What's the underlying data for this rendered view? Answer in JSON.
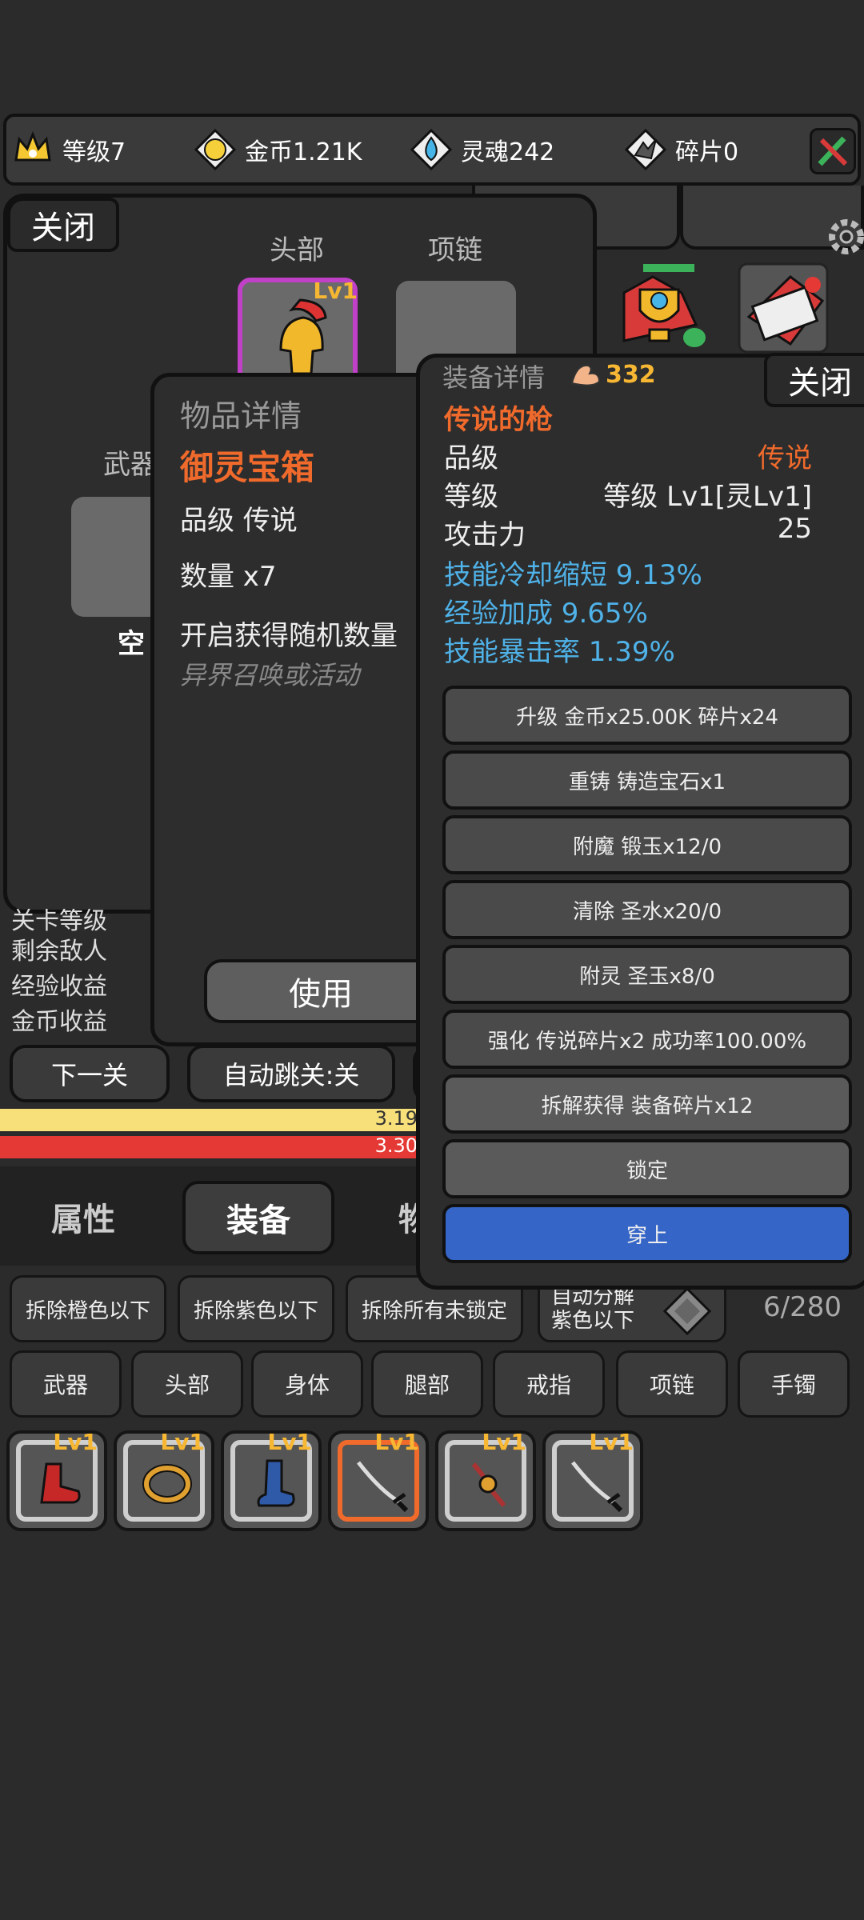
{
  "resources": {
    "level": "等级7",
    "gold": "金币1.21K",
    "soul": "灵魂242",
    "shard": "碎片0"
  },
  "equip_panel": {
    "close": "关闭",
    "slot_head": "头部",
    "slot_necklace": "项链",
    "slot_weapon": "武器",
    "empty": "空",
    "head_level": "Lv1"
  },
  "item_detail": {
    "header": "物品详情",
    "name": "御灵宝箱",
    "grade": "品级   传说",
    "quantity": "数量 x7",
    "desc": "开启获得随机数量",
    "source": "异界召唤或活动",
    "use": "使用"
  },
  "gear_detail": {
    "header": "装备详情",
    "power": "332",
    "close": "关闭",
    "name": "传说的枪",
    "grade_label": "品级",
    "grade_value": "传说",
    "level_label": "等级",
    "level_value": "等级 Lv1[灵Lv1]",
    "attack_label": "攻击力",
    "attack_value": "25",
    "stats": [
      "技能冷却缩短 9.13%",
      "经验加成 9.65%",
      "技能暴击率 1.39%"
    ],
    "actions": [
      "升级 金币x25.00K 碎片x24",
      "重铸 铸造宝石x1",
      "附魔 锻玉x12/0",
      "清除 圣水x20/0",
      "附灵 圣玉x8/0",
      "强化 传说碎片x2 成功率100.00%",
      "拆解获得 装备碎片x12",
      "锁定",
      "穿上"
    ]
  },
  "battle": {
    "cut_label": "关卡等级",
    "enemies_left": "剩余敌人",
    "exp_gain": "经验收益",
    "gold_gain": "金币收益",
    "next_stage": "下一关",
    "auto_skip": "自动跳关:关",
    "bar1": "3.19",
    "bar2": "3.30",
    "bar1_color": "#f7e07a",
    "bar2_color": "#e53935"
  },
  "tabs": {
    "attr": "属性",
    "equip": "装备",
    "items": "物"
  },
  "filters": {
    "dismantle_orange": "拆除橙色以下",
    "dismantle_purple": "拆除紫色以下",
    "dismantle_unlocked": "拆除所有未锁定",
    "auto_line1": "自动分解",
    "auto_line2": "紫色以下",
    "capacity": "6/280"
  },
  "categories": [
    "武器",
    "头部",
    "身体",
    "腿部",
    "戒指",
    "项链",
    "手镯"
  ],
  "inventory": [
    {
      "level": "Lv1",
      "icon": "red-boot-icon"
    },
    {
      "level": "Lv1",
      "icon": "gold-ring-icon"
    },
    {
      "level": "Lv1",
      "icon": "blue-boot-icon"
    },
    {
      "level": "Lv1",
      "icon": "sword-icon"
    },
    {
      "level": "Lv1",
      "icon": "amulet-icon"
    },
    {
      "level": "Lv1",
      "icon": "sword-icon"
    }
  ]
}
